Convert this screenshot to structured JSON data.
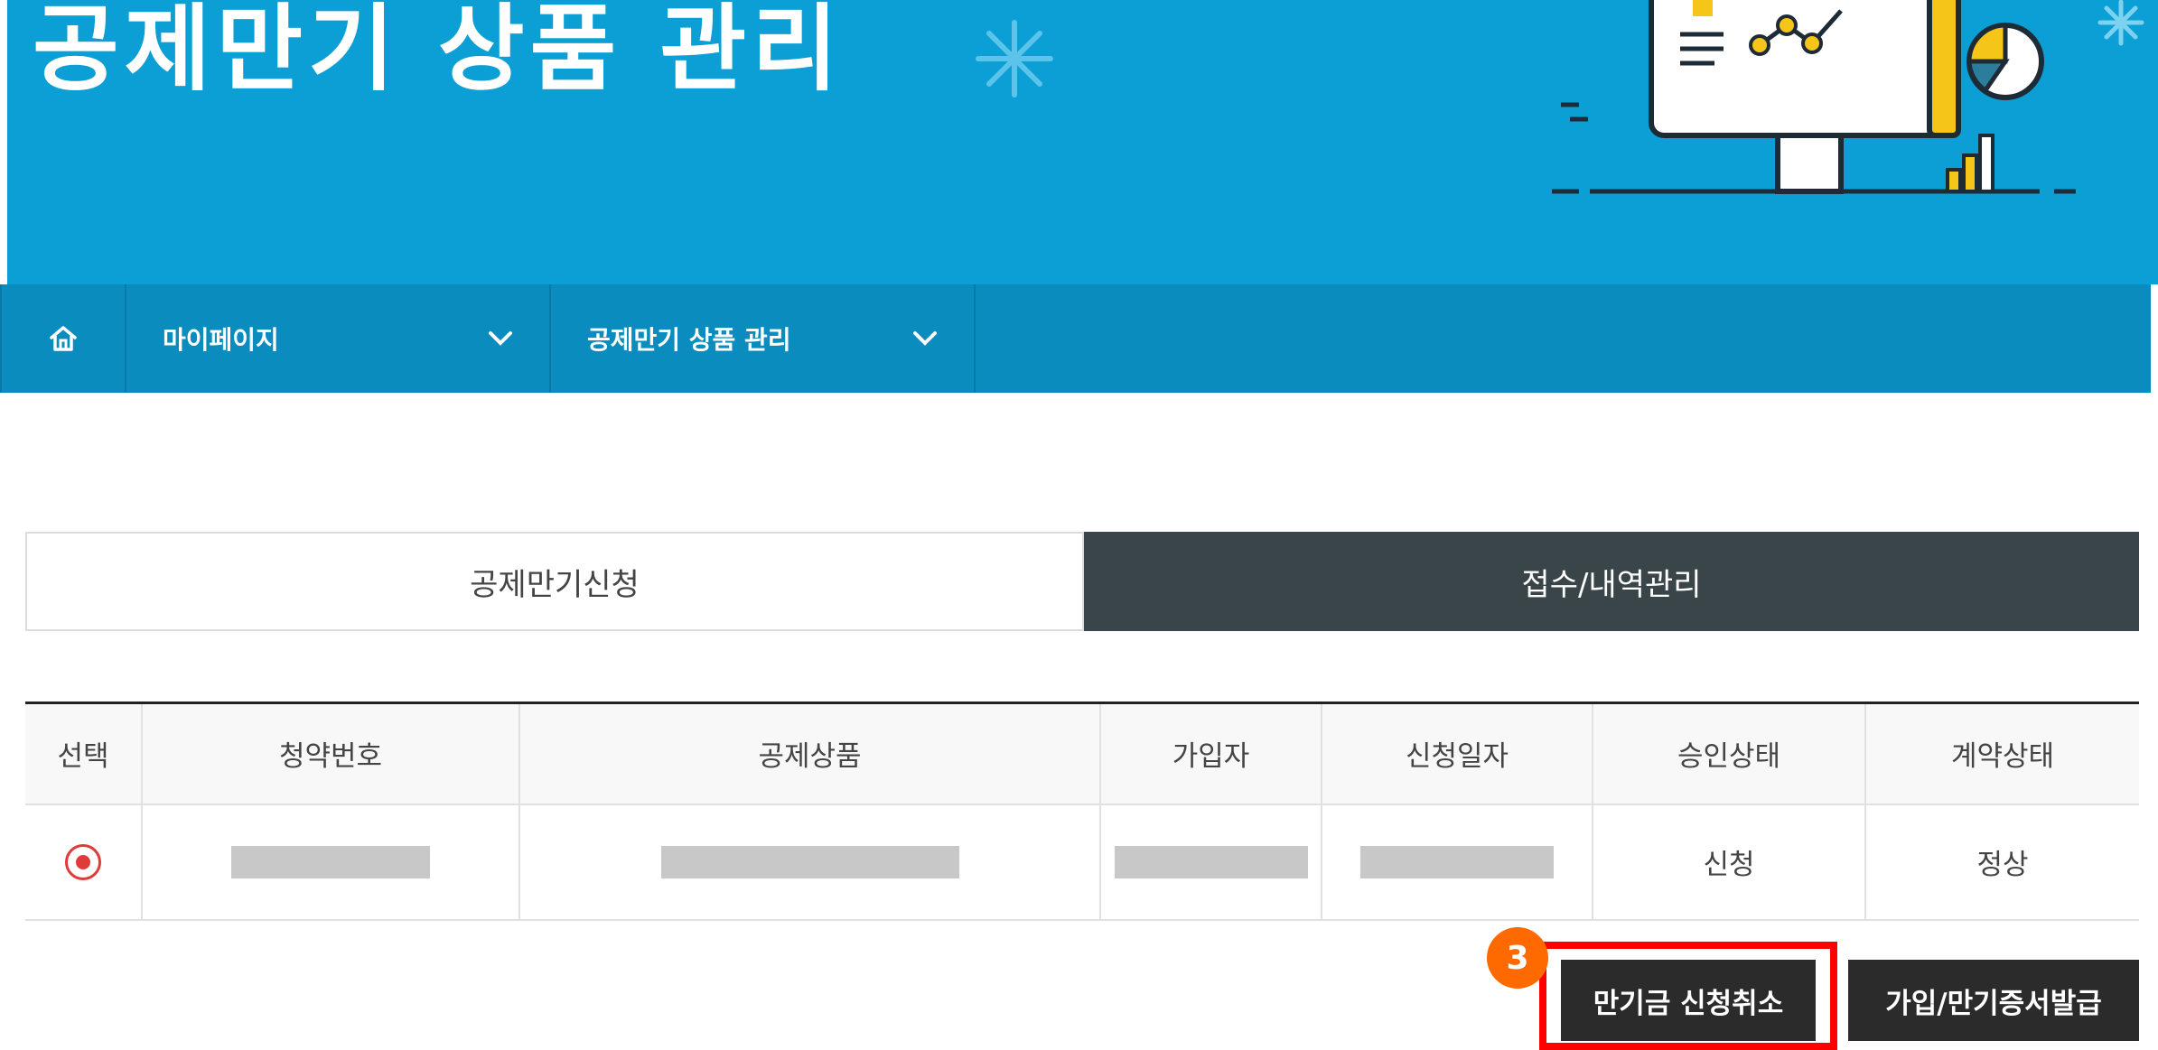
{
  "banner": {
    "title": "공제만기 상품 관리"
  },
  "breadcrumb": {
    "items": [
      {
        "label": "마이페이지"
      },
      {
        "label": "공제만기 상품 관리"
      }
    ]
  },
  "tabs": [
    {
      "label": "공제만기신청",
      "active": false
    },
    {
      "label": "접수/내역관리",
      "active": true
    }
  ],
  "table": {
    "headers": [
      "선택",
      "청약번호",
      "공제상품",
      "가입자",
      "신청일자",
      "승인상태",
      "계약상태"
    ],
    "rows": [
      {
        "approval_status": "신청",
        "contract_status": "정상"
      }
    ]
  },
  "annotation": {
    "step": "3"
  },
  "buttons": {
    "cancel_label": "만기금 신청취소",
    "certificate_label": "가입/만기증서발급"
  },
  "colors": {
    "banner": "#0b9fd5",
    "breadcrumb_bar": "#0a8cbf",
    "active_tab": "#394548",
    "button": "#2b2b2b",
    "highlight": "#ff0000",
    "step_badge": "#ff6a00",
    "radio": "#e03b3b"
  },
  "icons": [
    "home-icon",
    "chevron-down-icon",
    "sparkle-icon",
    "monitor-chart-illustration",
    "pie-chart-icon"
  ]
}
